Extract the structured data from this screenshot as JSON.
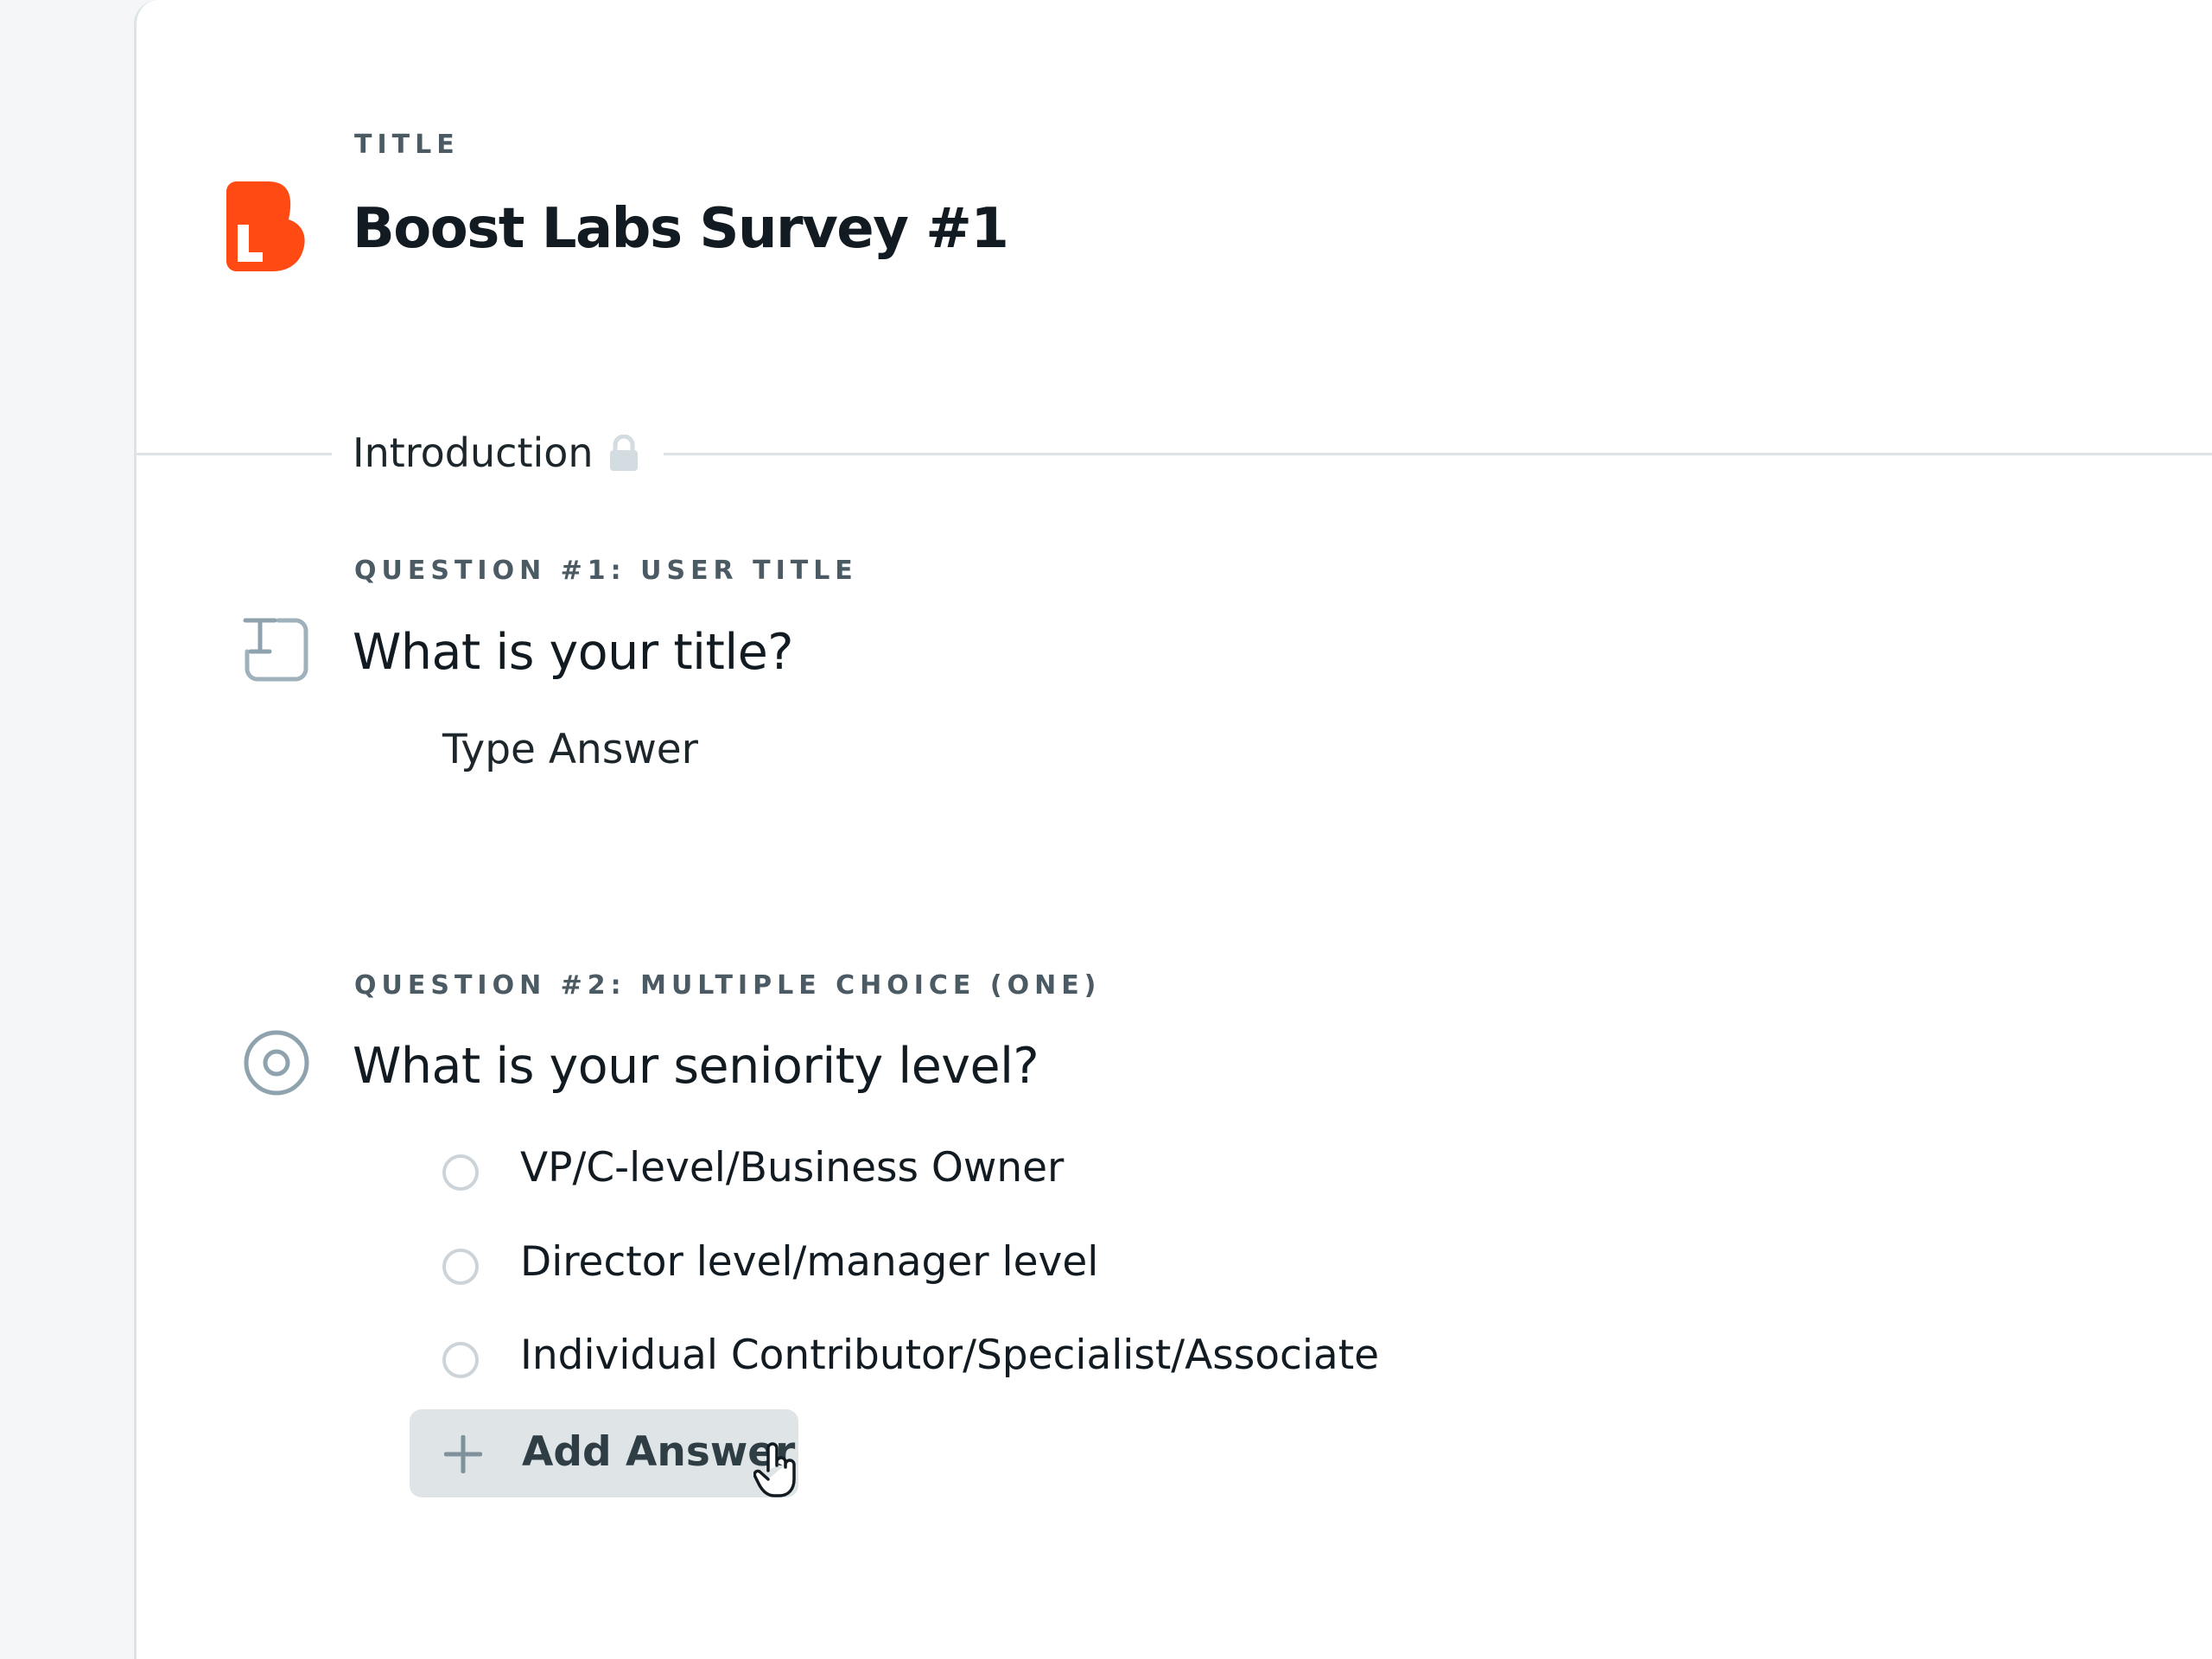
{
  "survey": {
    "title_kicker": "TITLE",
    "title": "Boost Labs Survey #1",
    "logo_letter": "L",
    "brand_color": "#ff4a14"
  },
  "section": {
    "label": "Introduction",
    "icon": "lock-icon"
  },
  "questions": [
    {
      "kicker": "QUESTION #1: USER TITLE",
      "icon": "text-input-icon",
      "text": "What is your title?",
      "answer_placeholder": "Type Answer"
    },
    {
      "kicker": "QUESTION #2: MULTIPLE CHOICE (ONE)",
      "icon": "radio-target-icon",
      "text": "What is your seniority level?",
      "options": [
        "VP/C-level/Business Owner",
        "Director level/manager level",
        "Individual Contributor/Specialist/Associate"
      ],
      "add_answer_label": "Add Answer"
    }
  ],
  "cursor": "hand-pointer-icon",
  "colors": {
    "text_primary": "#111b21",
    "text_muted": "#4b5a63",
    "divider": "#dde4e8",
    "icon_gray": "#8fa3ae",
    "button_bg": "#dfe4e7"
  }
}
